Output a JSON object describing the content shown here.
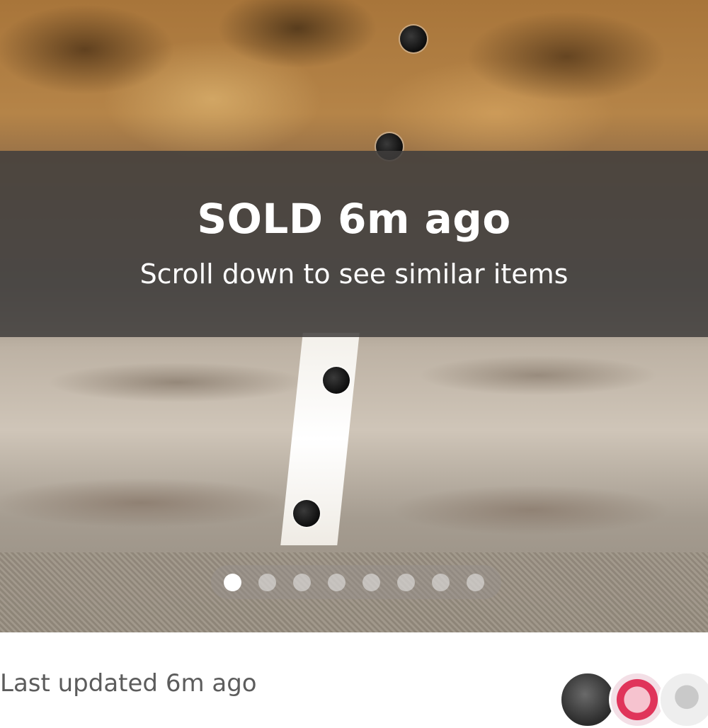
{
  "listing": {
    "status_title": "SOLD 6m ago",
    "status_subtitle": "Scroll down to see similar items",
    "photo_count": 8,
    "active_photo_index": 0,
    "photo_icon": "fur-coat-photo"
  },
  "footer": {
    "last_updated": "Last updated 6m ago",
    "avatars": [
      "user-avatar",
      "user-avatar",
      "user-avatar"
    ]
  },
  "colors": {
    "overlay": "#403e3c",
    "footer_text": "#5c5c5c",
    "pager_active": "#ffffff"
  }
}
